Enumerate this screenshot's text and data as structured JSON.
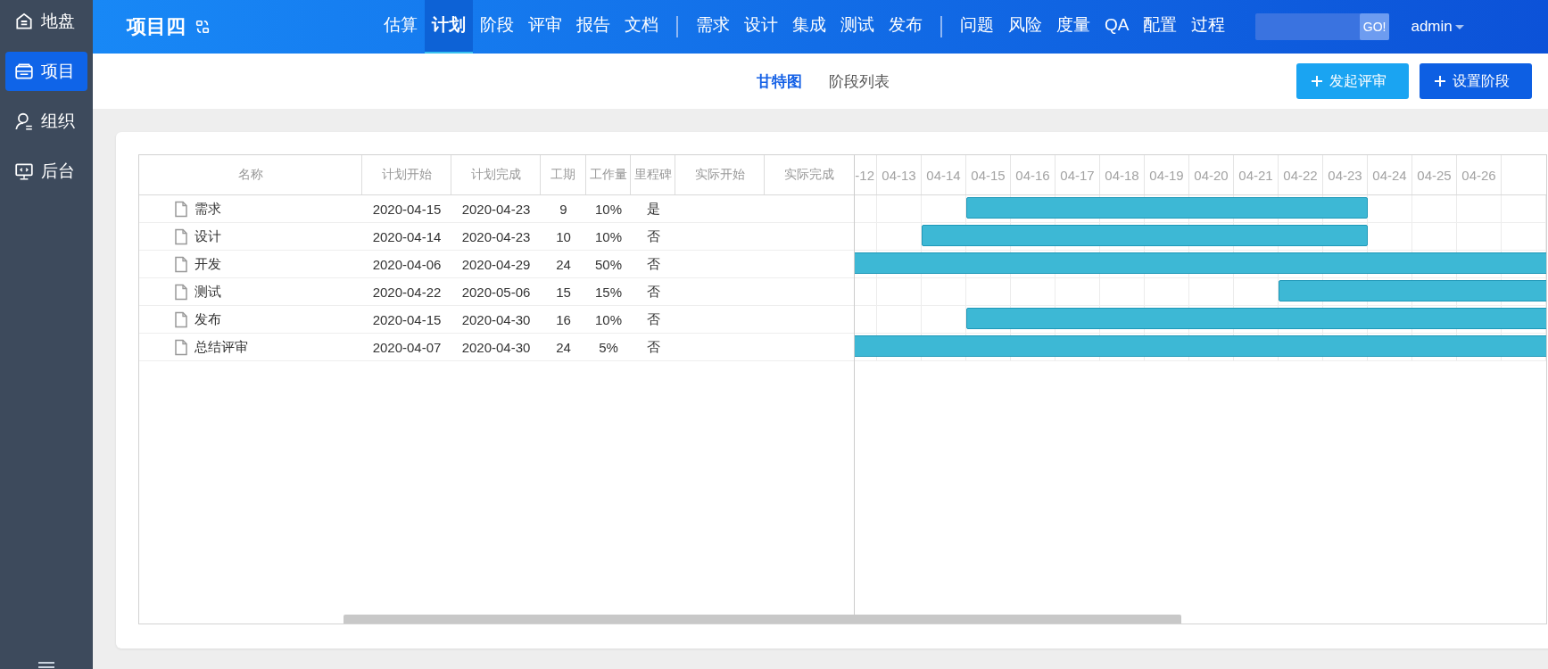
{
  "sidebar": {
    "items": [
      {
        "label": "地盘",
        "selected": false
      },
      {
        "label": "项目",
        "selected": true
      },
      {
        "label": "组织",
        "selected": false
      },
      {
        "label": "后台",
        "selected": false
      }
    ]
  },
  "topbar": {
    "project_title": "项目四",
    "nav_groups": [
      [
        {
          "label": "估算",
          "selected": false
        },
        {
          "label": "计划",
          "selected": true
        },
        {
          "label": "阶段",
          "selected": false
        },
        {
          "label": "评审",
          "selected": false
        },
        {
          "label": "报告",
          "selected": false
        },
        {
          "label": "文档",
          "selected": false
        }
      ],
      [
        {
          "label": "需求",
          "selected": false
        },
        {
          "label": "设计",
          "selected": false
        },
        {
          "label": "集成",
          "selected": false
        },
        {
          "label": "测试",
          "selected": false
        },
        {
          "label": "发布",
          "selected": false
        }
      ],
      [
        {
          "label": "问题",
          "selected": false
        },
        {
          "label": "风险",
          "selected": false
        },
        {
          "label": "度量",
          "selected": false
        },
        {
          "label": "QA",
          "selected": false
        },
        {
          "label": "配置",
          "selected": false
        },
        {
          "label": "过程",
          "selected": false
        }
      ]
    ],
    "search_button": "GO!",
    "user": "admin"
  },
  "view_tabs": [
    {
      "label": "甘特图",
      "selected": true
    },
    {
      "label": "阶段列表",
      "selected": false
    }
  ],
  "buttons": [
    {
      "label": "发起评审",
      "kind": "secondary"
    },
    {
      "label": "设置阶段",
      "kind": "primary"
    }
  ],
  "table": {
    "columns": [
      "名称",
      "计划开始",
      "计划完成",
      "工期",
      "工作量",
      "里程碑",
      "实际开始",
      "实际完成"
    ],
    "rows": [
      {
        "name": "需求",
        "plan_start": "2020-04-15",
        "plan_end": "2020-04-23",
        "duration": "9",
        "workload": "10%",
        "milestone": "是"
      },
      {
        "name": "设计",
        "plan_start": "2020-04-14",
        "plan_end": "2020-04-23",
        "duration": "10",
        "workload": "10%",
        "milestone": "否"
      },
      {
        "name": "开发",
        "plan_start": "2020-04-06",
        "plan_end": "2020-04-29",
        "duration": "24",
        "workload": "50%",
        "milestone": "否"
      },
      {
        "name": "测试",
        "plan_start": "2020-04-22",
        "plan_end": "2020-05-06",
        "duration": "15",
        "workload": "15%",
        "milestone": "否"
      },
      {
        "name": "发布",
        "plan_start": "2020-04-15",
        "plan_end": "2020-04-30",
        "duration": "16",
        "workload": "10%",
        "milestone": "否"
      },
      {
        "name": "总结评审",
        "plan_start": "2020-04-07",
        "plan_end": "2020-04-30",
        "duration": "24",
        "workload": "5%",
        "milestone": "否"
      }
    ]
  },
  "gantt": {
    "days": [
      "-12",
      "04-13",
      "04-14",
      "04-15",
      "04-16",
      "04-17",
      "04-18",
      "04-19",
      "04-20",
      "04-21",
      "04-22",
      "04-23",
      "04-24",
      "04-25",
      "04-26"
    ]
  }
}
